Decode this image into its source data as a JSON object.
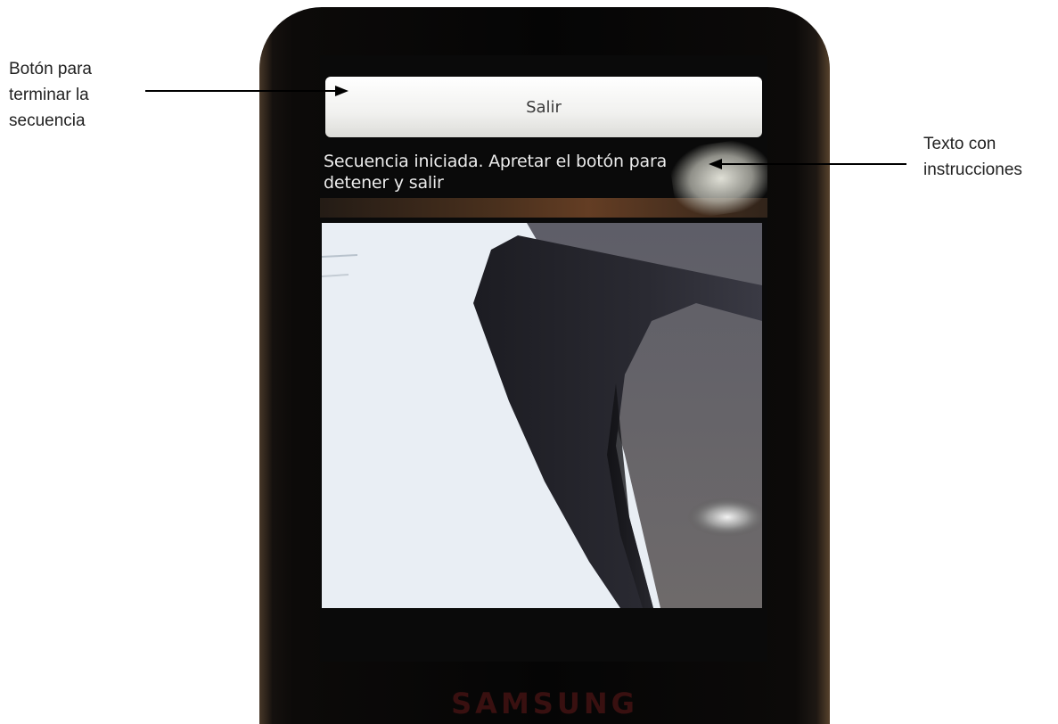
{
  "annotations": {
    "left_lines": [
      "Botón para",
      "terminar la",
      "secuencia"
    ],
    "right_lines": [
      "Texto con",
      "instrucciones"
    ]
  },
  "app": {
    "exit_button_label": "Salir",
    "instructions_text": "Secuencia iniciada. Apretar el botón para detener y salir"
  },
  "device": {
    "brand": "SAMSUNG"
  },
  "colors": {
    "annotation_text": "#222222",
    "arrow": "#000000",
    "button_text": "#3a3a3a",
    "instructions_text": "#ececec"
  }
}
